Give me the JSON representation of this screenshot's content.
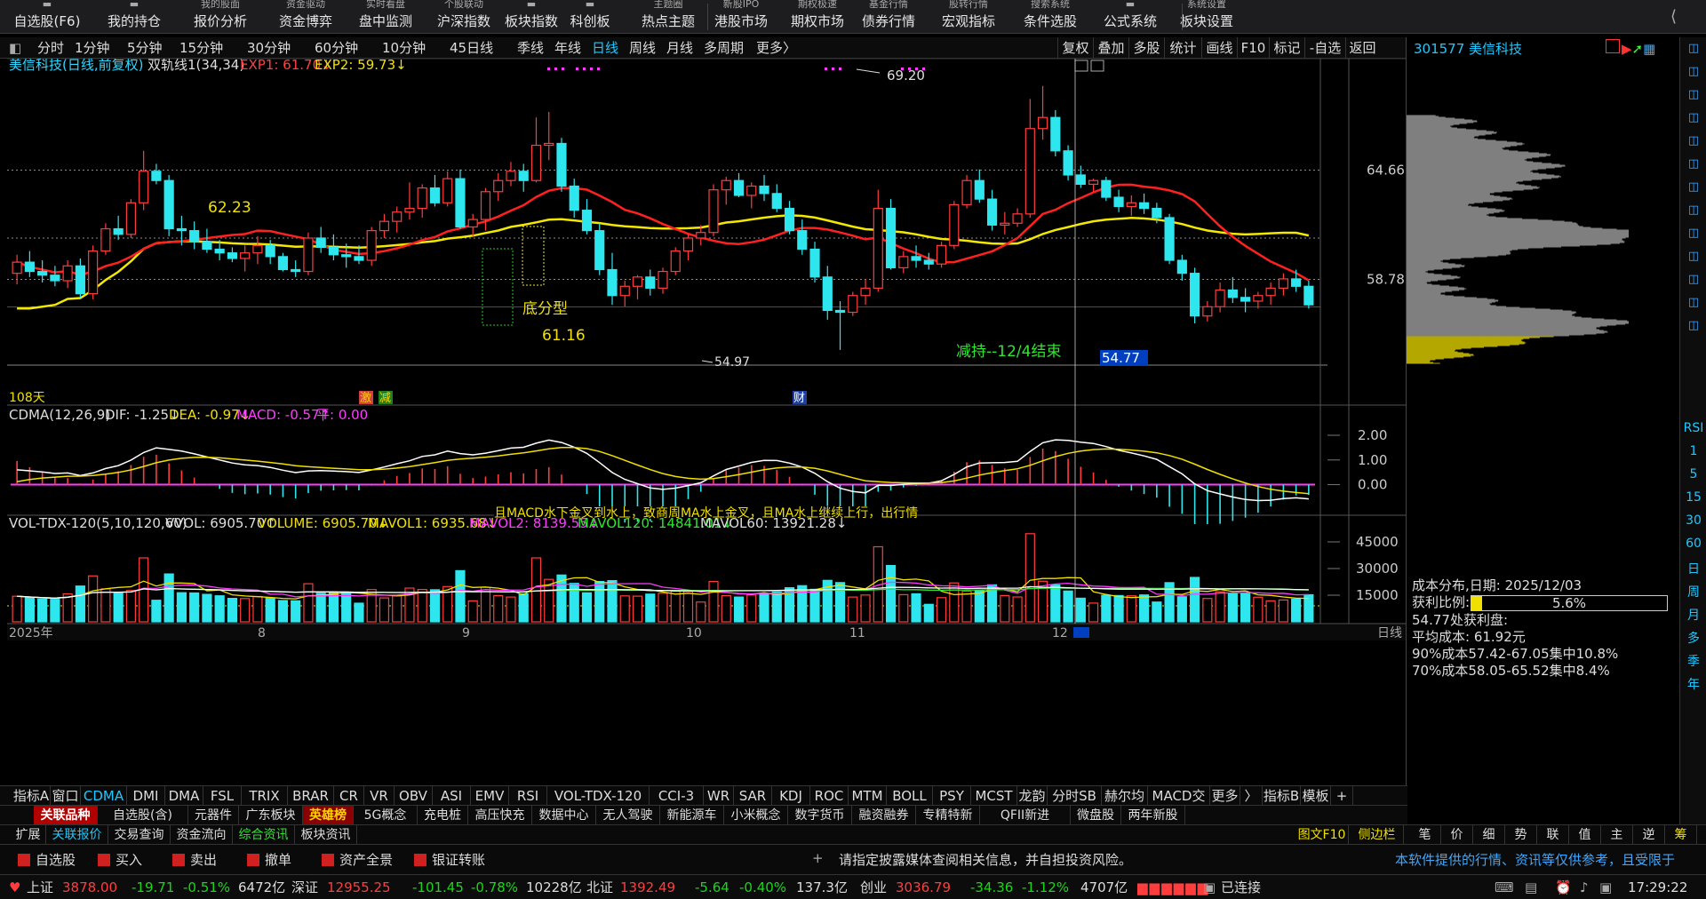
{
  "toolbar": {
    "items": [
      {
        "label": "自选股(F6)",
        "icon": "star-icon"
      },
      {
        "label": "我的持仓",
        "icon": "wallet-icon"
      },
      {
        "top": "我的股面",
        "label": "报价分析",
        "icon": "quote-icon"
      },
      {
        "top": "资金驱动",
        "label": "资金博弈",
        "icon": "money-icon"
      },
      {
        "top": "实时看盘",
        "label": "盘中监测",
        "icon": "monitor-icon"
      },
      {
        "top": "个股联动",
        "label": "沪深指数",
        "icon": "index-icon"
      },
      {
        "label": "板块指数",
        "icon": "sector-icon"
      },
      {
        "label": "科创板",
        "icon": "star-board-icon"
      },
      {
        "top": "主题圈",
        "label": "热点主题",
        "icon": "theme-icon"
      },
      {
        "top": "新股IPO",
        "label": "港股市场",
        "icon": "hk-icon"
      },
      {
        "top": "期权极速",
        "label": "期权市场",
        "icon": "option-icon"
      },
      {
        "top": "基金行情",
        "label": "债券行情",
        "icon": "bond-icon"
      },
      {
        "top": "股转行情",
        "label": "宏观指标",
        "icon": "macro-icon"
      },
      {
        "top": "搜索系统",
        "label": "条件选股",
        "icon": "filter-icon"
      },
      {
        "label": "公式系统",
        "icon": "formula-icon"
      },
      {
        "top": "系统设置",
        "label": "板块设置",
        "icon": "settings-icon"
      }
    ]
  },
  "periods": [
    "分时",
    "1分钟",
    "5分钟",
    "15分钟",
    "30分钟",
    "60分钟",
    "10分钟",
    "45日线",
    "季线",
    "年线",
    "日线",
    "周线",
    "月线",
    "多周期",
    "更多〉"
  ],
  "active_period": "日线",
  "right_buttons": [
    "复权",
    "叠加",
    "多股",
    "统计",
    "画线",
    "F10",
    "标记",
    "-自选",
    "返回"
  ],
  "stock": {
    "code_name": "301577 美信科技",
    "title": "美信科技(日线,前复权)",
    "indicator": "双轨线1(34,34)",
    "exp1": "EXP1: 61.70↓",
    "exp2": "EXP2: 59.73↓"
  },
  "annotations": {
    "high": "69.20",
    "low": "54.97",
    "a1": "62.23",
    "a2": "61.16",
    "pattern": "底分型",
    "note": "减持--12/4结束",
    "days": "108天",
    "tag_ji": "激",
    "tag_jian": "减",
    "tag_cai": "财",
    "price_box": "54.77"
  },
  "chart_data": {
    "type": "candlestick",
    "ylim": [
      54.77,
      69.2
    ],
    "price_ticks": [
      "64.66",
      "58.78"
    ],
    "macd_ticks": [
      "2.00",
      "1.00",
      "0.00"
    ],
    "vol_ticks": [
      "45000",
      "30000",
      "15000"
    ],
    "ohlc": [
      [
        59.1,
        60.1,
        58.5,
        59.7
      ],
      [
        59.7,
        60.3,
        58.9,
        59.2
      ],
      [
        59.2,
        59.8,
        58.6,
        59.0
      ],
      [
        59.0,
        59.5,
        58.4,
        58.7
      ],
      [
        58.7,
        59.8,
        58.3,
        59.5
      ],
      [
        59.5,
        59.9,
        57.8,
        58.0
      ],
      [
        58.0,
        60.6,
        57.7,
        60.3
      ],
      [
        60.3,
        61.8,
        60.1,
        61.5
      ],
      [
        61.5,
        62.2,
        60.9,
        61.2
      ],
      [
        61.2,
        63.1,
        61.0,
        62.9
      ],
      [
        62.9,
        65.7,
        62.5,
        64.6
      ],
      [
        64.6,
        65.0,
        63.9,
        64.1
      ],
      [
        64.1,
        64.4,
        61.1,
        61.5
      ],
      [
        61.5,
        62.2,
        60.6,
        61.4
      ],
      [
        61.4,
        61.9,
        60.4,
        60.8
      ],
      [
        60.8,
        61.5,
        60.2,
        60.4
      ],
      [
        60.4,
        60.9,
        59.8,
        60.2
      ],
      [
        60.2,
        60.5,
        59.7,
        59.9
      ],
      [
        59.9,
        60.6,
        59.2,
        60.2
      ],
      [
        60.2,
        61.1,
        59.6,
        60.6
      ],
      [
        60.6,
        60.9,
        59.6,
        60.0
      ],
      [
        60.0,
        60.2,
        59.2,
        59.3
      ],
      [
        59.3,
        59.8,
        58.9,
        59.2
      ],
      [
        59.2,
        61.3,
        59.0,
        61.0
      ],
      [
        61.0,
        61.6,
        60.2,
        60.5
      ],
      [
        60.5,
        61.2,
        59.8,
        60.1
      ],
      [
        60.1,
        60.7,
        59.4,
        60.0
      ],
      [
        60.0,
        60.6,
        59.6,
        59.8
      ],
      [
        59.8,
        61.6,
        59.5,
        61.4
      ],
      [
        61.4,
        62.3,
        61.0,
        61.9
      ],
      [
        61.9,
        62.7,
        61.3,
        62.4
      ],
      [
        62.4,
        64.0,
        62.0,
        62.6
      ],
      [
        62.6,
        63.9,
        62.1,
        63.7
      ],
      [
        63.7,
        64.4,
        62.7,
        62.9
      ],
      [
        62.9,
        64.6,
        62.7,
        64.2
      ],
      [
        64.2,
        64.7,
        61.5,
        61.6
      ],
      [
        61.6,
        62.3,
        61.1,
        62.0
      ],
      [
        62.0,
        63.7,
        61.4,
        63.5
      ],
      [
        63.5,
        64.5,
        63.0,
        64.1
      ],
      [
        64.1,
        65.1,
        63.8,
        64.6
      ],
      [
        64.6,
        65.0,
        63.5,
        64.1
      ],
      [
        64.1,
        67.5,
        64.0,
        66.0
      ],
      [
        66.0,
        67.8,
        65.2,
        66.1
      ],
      [
        66.1,
        66.4,
        63.5,
        63.8
      ],
      [
        63.8,
        64.2,
        62.1,
        62.5
      ],
      [
        62.5,
        63.1,
        61.2,
        61.4
      ],
      [
        61.4,
        61.8,
        59.0,
        59.3
      ],
      [
        59.3,
        60.2,
        57.4,
        57.9
      ],
      [
        57.9,
        58.7,
        57.3,
        58.4
      ],
      [
        58.4,
        59.0,
        57.7,
        58.9
      ],
      [
        58.9,
        59.3,
        57.9,
        58.3
      ],
      [
        58.3,
        59.4,
        58.0,
        59.2
      ],
      [
        59.2,
        60.5,
        59.0,
        60.3
      ],
      [
        60.3,
        61.2,
        59.8,
        61.0
      ],
      [
        61.0,
        61.7,
        60.6,
        61.3
      ],
      [
        61.3,
        63.9,
        61.1,
        63.6
      ],
      [
        63.6,
        64.3,
        62.8,
        64.1
      ],
      [
        64.1,
        64.5,
        63.2,
        63.3
      ],
      [
        63.3,
        64.0,
        62.6,
        63.8
      ],
      [
        63.8,
        64.4,
        63.0,
        63.4
      ],
      [
        63.4,
        63.9,
        62.4,
        62.6
      ],
      [
        62.6,
        63.0,
        61.2,
        61.4
      ],
      [
        61.4,
        62.0,
        60.1,
        60.4
      ],
      [
        60.4,
        60.8,
        58.6,
        58.9
      ],
      [
        58.9,
        59.5,
        56.6,
        57.1
      ],
      [
        57.1,
        57.6,
        54.97,
        57.0
      ],
      [
        57.0,
        58.1,
        56.8,
        57.9
      ],
      [
        57.9,
        58.8,
        57.4,
        58.3
      ],
      [
        58.3,
        63.6,
        58.1,
        62.6
      ],
      [
        62.6,
        63.1,
        59.3,
        59.4
      ],
      [
        59.4,
        60.3,
        59.1,
        60.0
      ],
      [
        60.0,
        60.6,
        59.4,
        59.8
      ],
      [
        59.8,
        60.2,
        59.3,
        59.6
      ],
      [
        59.6,
        60.8,
        59.4,
        60.6
      ],
      [
        60.6,
        63.0,
        60.4,
        62.8
      ],
      [
        62.8,
        64.4,
        62.6,
        64.1
      ],
      [
        64.1,
        64.7,
        62.9,
        63.1
      ],
      [
        63.1,
        63.6,
        61.4,
        61.7
      ],
      [
        61.7,
        62.4,
        61.2,
        61.8
      ],
      [
        61.8,
        62.6,
        61.6,
        62.3
      ],
      [
        62.3,
        68.5,
        62.1,
        66.9
      ],
      [
        66.9,
        69.2,
        66.3,
        67.5
      ],
      [
        67.5,
        67.9,
        65.4,
        65.7
      ],
      [
        65.7,
        66.0,
        64.1,
        64.4
      ],
      [
        64.4,
        64.9,
        63.7,
        63.9
      ],
      [
        63.9,
        64.2,
        63.5,
        64.1
      ],
      [
        64.1,
        64.3,
        63.0,
        63.2
      ],
      [
        63.2,
        63.6,
        62.4,
        62.7
      ],
      [
        62.7,
        63.3,
        62.2,
        62.9
      ],
      [
        62.9,
        63.4,
        62.3,
        62.6
      ],
      [
        62.6,
        62.9,
        61.8,
        62.1
      ],
      [
        62.1,
        62.3,
        59.6,
        59.8
      ],
      [
        59.8,
        60.1,
        58.7,
        59.1
      ],
      [
        59.1,
        59.4,
        56.4,
        56.8
      ],
      [
        56.8,
        57.6,
        56.5,
        57.3
      ],
      [
        57.3,
        58.6,
        57.0,
        58.2
      ],
      [
        58.2,
        58.9,
        57.5,
        57.8
      ],
      [
        57.8,
        58.3,
        57.0,
        57.6
      ],
      [
        57.6,
        58.1,
        57.2,
        57.9
      ],
      [
        57.9,
        58.6,
        57.4,
        58.3
      ],
      [
        58.3,
        59.1,
        57.9,
        58.8
      ],
      [
        58.8,
        59.3,
        58.1,
        58.4
      ],
      [
        58.4,
        58.7,
        57.2,
        57.4
      ]
    ],
    "volume_scale": "relative",
    "macd_line_note": "DIF/DEA"
  },
  "macd": {
    "title": "CDMA(12,26,9)",
    "dif": "DIF: -1.25↓",
    "dea": "DEA: -0.97↓",
    "macd": "MACD: -0.57↑",
    "ping": "平: 0.00",
    "overlay": "且MACD水下金叉到水上，致商周MA水上金叉，且MA水上继续上行，出行情"
  },
  "vol": {
    "title": "VOL-TDX-120(5,10,120,60)",
    "vvol": "VVOL: 6905.70↑",
    "volume": "VOLUME: 6905.70↓",
    "m1": "MAVOL1: 6935.68↓",
    "m2": "MAVOL2: 8139.55↓",
    "m3": "MAVOL120: 14841.01↓",
    "m4": "MAVOL60: 13921.28↓"
  },
  "axis_dates": {
    "y2025": "2025年",
    "m8": "8",
    "m9": "9",
    "m10": "10",
    "m11": "11",
    "m12": "12",
    "period": "日线"
  },
  "indicator_tabs": [
    "指标A",
    "窗口",
    "CDMA",
    "DMI",
    "DMA",
    "FSL",
    "TRIX",
    "BRAR",
    "CR",
    "VR",
    "OBV",
    "ASI",
    "EMV",
    "RSI",
    "VOL-TDX-120",
    "CCI-3",
    "WR",
    "SAR",
    "KDJ",
    "ROC",
    "MTM",
    "BOLL",
    "PSY",
    "MCST",
    "龙韵",
    "分时SB点",
    "赫尔均线",
    "MACD交易",
    "更多",
    "〉",
    "指标B",
    "模板",
    "+"
  ],
  "board_tabs": [
    "关联品种",
    "自选股(含)",
    "元器件",
    "广东板块",
    "英雄榜",
    "5G概念",
    "充电桩",
    "高压快充",
    "数据中心",
    "无人驾驶",
    "新能源车",
    "小米概念",
    "数字货币",
    "融资融券",
    "专精特新",
    "QFII新进",
    "微盘股",
    "两年新股"
  ],
  "bottom_tabs": [
    "扩展",
    "关联报价",
    "交易查询",
    "资金流向",
    "综合资讯",
    "板块资讯"
  ],
  "bottom_right": [
    "图文F10",
    "侧边栏"
  ],
  "side_tabs": [
    "笔",
    "价",
    "细",
    "势",
    "联",
    "值",
    "主",
    "逆",
    "筹"
  ],
  "quick_actions": [
    "自选股",
    "买入",
    "卖出",
    "撤单",
    "资产全景",
    "银证转账"
  ],
  "ticker_notice": "请指定披露媒体查阅相关信息，并自担投资风险。",
  "disclaimer": "本软件提供的行情、资讯等仅供参考，且受限于",
  "cost": {
    "title": "成本分布,日期: 2025/12/03",
    "profit_label": "获利比例:",
    "profit": "5.6%",
    "at": "54.77处获利盘:",
    "avg": "平均成本: 61.92元",
    "r90": "90%成本57.42-67.05集中10.8%",
    "r70": "70%成本58.05-65.52集中8.4%"
  },
  "status": {
    "sh": "上证",
    "sh_v": "3878.00",
    "sh_c": "-19.71",
    "sh_p": "-0.51%",
    "sh_a": "6472亿",
    "sz": "深证",
    "sz_v": "12955.25",
    "sz_c": "-101.45",
    "sz_p": "-0.78%",
    "sz_a": "10228亿",
    "bz": "北证",
    "bz_v": "1392.49",
    "bz_c": "-5.64",
    "bz_p": "-0.40%",
    "bz_a": "137.3亿",
    "cy": "创业",
    "cy_v": "3036.79",
    "cy_c": "-34.36",
    "cy_p": "-1.12%",
    "cy_a": "4707亿",
    "conn": "已连接",
    "time": "17:29:22"
  },
  "vt_labels": [
    "RSI",
    "1",
    "5",
    "15",
    "30",
    "60",
    "日",
    "周",
    "月",
    "多",
    "季",
    "年"
  ],
  "colors": {
    "up": "#ff3d3d",
    "down": "#2ee6ee",
    "ma_red": "#ff2020",
    "ma_yellow": "#f3e800",
    "accent": "#1ec8ff"
  }
}
